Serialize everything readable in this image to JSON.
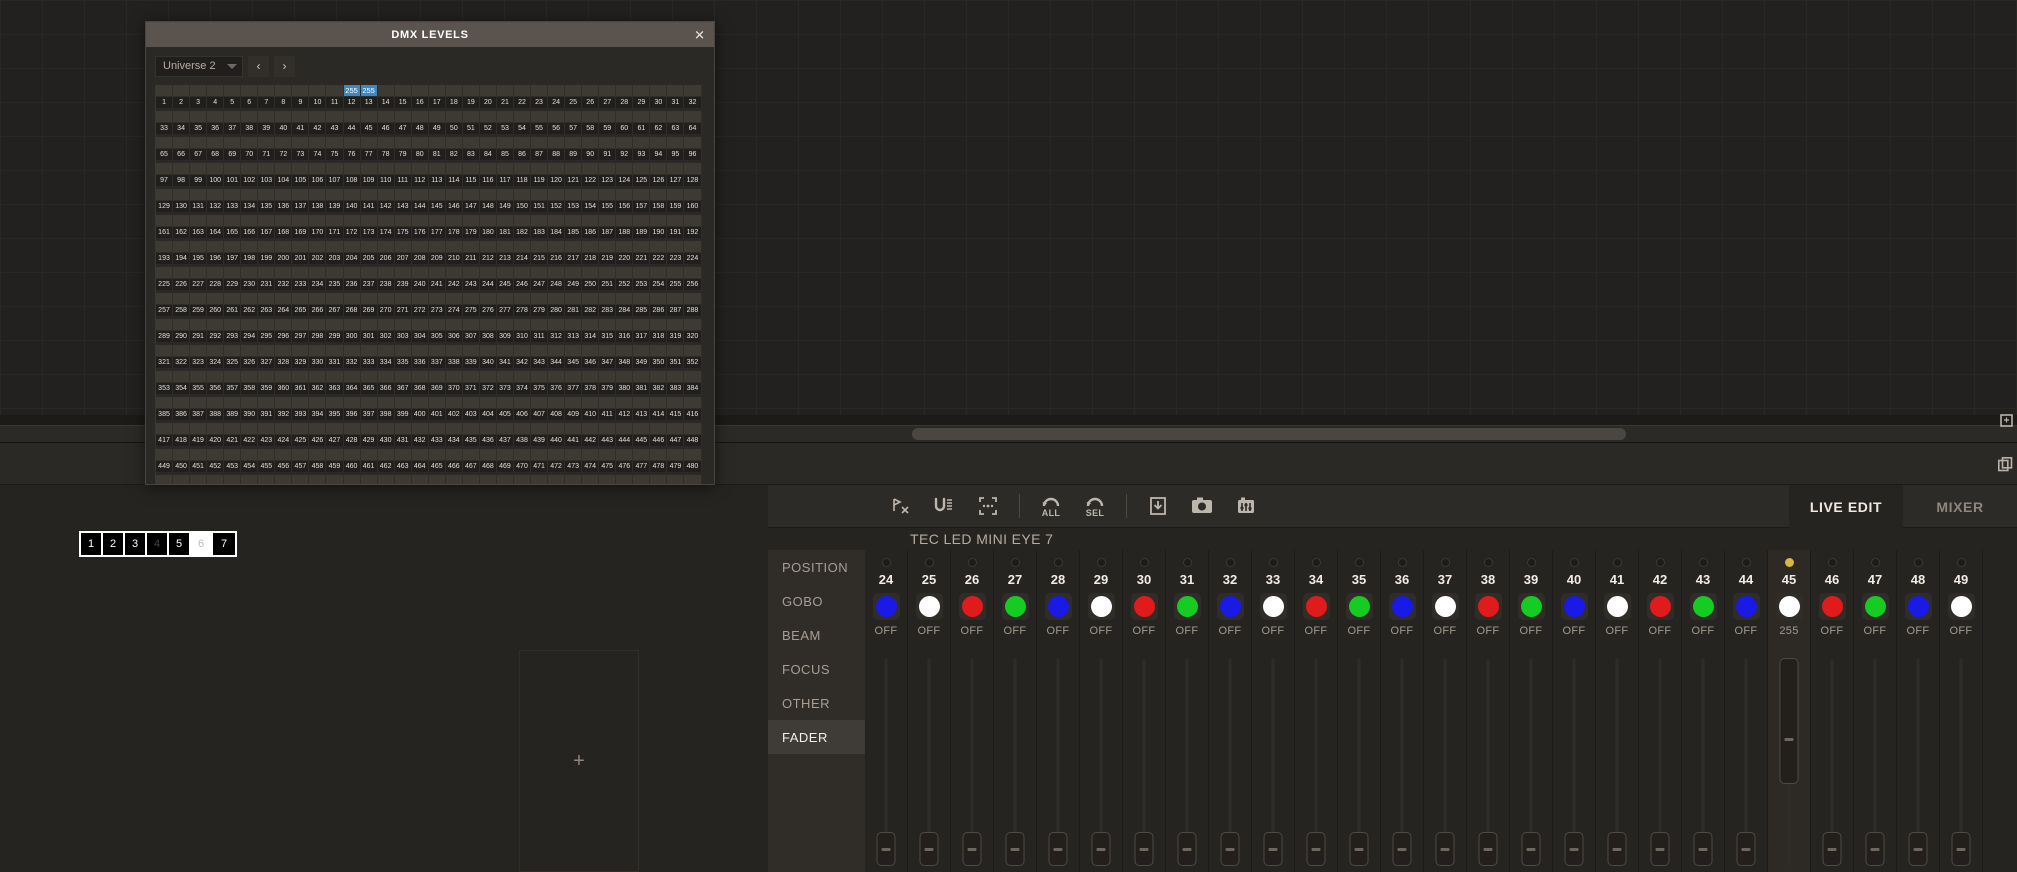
{
  "dialog": {
    "title": "DMX LEVELS",
    "close_icon": "close-icon",
    "universe_label": "Universe 2",
    "prev_label": "‹",
    "next_label": "›",
    "channels_total": 512,
    "channels_per_row": 32,
    "active_values": {
      "12": "255",
      "13": "255"
    }
  },
  "background": {
    "scroll_hint": "horizontal-scrollbar"
  },
  "toolbar": {
    "buttons": [
      {
        "name": "blind-icon",
        "label": ""
      },
      {
        "name": "highlight-icon",
        "label": ""
      },
      {
        "name": "select-all-icon",
        "label": ""
      },
      {
        "name": "release-all-icon",
        "label": "ALL"
      },
      {
        "name": "release-sel-icon",
        "label": "SEL"
      },
      {
        "name": "record-icon",
        "label": ""
      },
      {
        "name": "snapshot-icon",
        "label": ""
      },
      {
        "name": "settings-icon",
        "label": ""
      }
    ]
  },
  "tabs": [
    {
      "label": "LIVE EDIT",
      "active": true
    },
    {
      "label": "MIXER",
      "active": false
    }
  ],
  "fixture": {
    "name": "TEC LED MINI EYE 7"
  },
  "categories": [
    {
      "label": "POSITION",
      "active": false
    },
    {
      "label": "GOBO",
      "active": false
    },
    {
      "label": "BEAM",
      "active": false
    },
    {
      "label": "FOCUS",
      "active": false
    },
    {
      "label": "OTHER",
      "active": false
    },
    {
      "label": "FADER",
      "active": true
    }
  ],
  "colors": {
    "accent_blue": "#3e87c4",
    "selected_dot": "#d9b544",
    "red": "#e01b1b",
    "green": "#14cc22",
    "blue": "#1a1ae6",
    "white": "#ffffff",
    "panel": "#262421",
    "title_bar": "#5b544e"
  },
  "strips": [
    {
      "num": "24",
      "value": "OFF",
      "color": "#1a1ae6",
      "selected": false
    },
    {
      "num": "25",
      "value": "OFF",
      "color": "#ffffff",
      "selected": false
    },
    {
      "num": "26",
      "value": "OFF",
      "color": "#e01b1b",
      "selected": false
    },
    {
      "num": "27",
      "value": "OFF",
      "color": "#14cc22",
      "selected": false
    },
    {
      "num": "28",
      "value": "OFF",
      "color": "#1a1ae6",
      "selected": false
    },
    {
      "num": "29",
      "value": "OFF",
      "color": "#ffffff",
      "selected": false
    },
    {
      "num": "30",
      "value": "OFF",
      "color": "#e01b1b",
      "selected": false
    },
    {
      "num": "31",
      "value": "OFF",
      "color": "#14cc22",
      "selected": false
    },
    {
      "num": "32",
      "value": "OFF",
      "color": "#1a1ae6",
      "selected": false
    },
    {
      "num": "33",
      "value": "OFF",
      "color": "#ffffff",
      "selected": false
    },
    {
      "num": "34",
      "value": "OFF",
      "color": "#e01b1b",
      "selected": false
    },
    {
      "num": "35",
      "value": "OFF",
      "color": "#14cc22",
      "selected": false
    },
    {
      "num": "36",
      "value": "OFF",
      "color": "#1a1ae6",
      "selected": false
    },
    {
      "num": "37",
      "value": "OFF",
      "color": "#ffffff",
      "selected": false
    },
    {
      "num": "38",
      "value": "OFF",
      "color": "#e01b1b",
      "selected": false
    },
    {
      "num": "39",
      "value": "OFF",
      "color": "#14cc22",
      "selected": false
    },
    {
      "num": "40",
      "value": "OFF",
      "color": "#1a1ae6",
      "selected": false
    },
    {
      "num": "41",
      "value": "OFF",
      "color": "#ffffff",
      "selected": false
    },
    {
      "num": "42",
      "value": "OFF",
      "color": "#e01b1b",
      "selected": false
    },
    {
      "num": "43",
      "value": "OFF",
      "color": "#14cc22",
      "selected": false
    },
    {
      "num": "44",
      "value": "OFF",
      "color": "#1a1ae6",
      "selected": false
    },
    {
      "num": "45",
      "value": "255",
      "color": "#ffffff",
      "selected": true
    },
    {
      "num": "46",
      "value": "OFF",
      "color": "#e01b1b",
      "selected": false
    },
    {
      "num": "47",
      "value": "OFF",
      "color": "#14cc22",
      "selected": false
    },
    {
      "num": "48",
      "value": "OFF",
      "color": "#1a1ae6",
      "selected": false
    },
    {
      "num": "49",
      "value": "OFF",
      "color": "#ffffff",
      "selected": false
    }
  ],
  "pages": [
    {
      "label": "1",
      "state": "normal"
    },
    {
      "label": "2",
      "state": "normal"
    },
    {
      "label": "3",
      "state": "normal"
    },
    {
      "label": "4",
      "state": "dim"
    },
    {
      "label": "5",
      "state": "normal"
    },
    {
      "label": "6",
      "state": "active"
    },
    {
      "label": "7",
      "state": "normal"
    }
  ],
  "add_button": {
    "label": "+"
  }
}
